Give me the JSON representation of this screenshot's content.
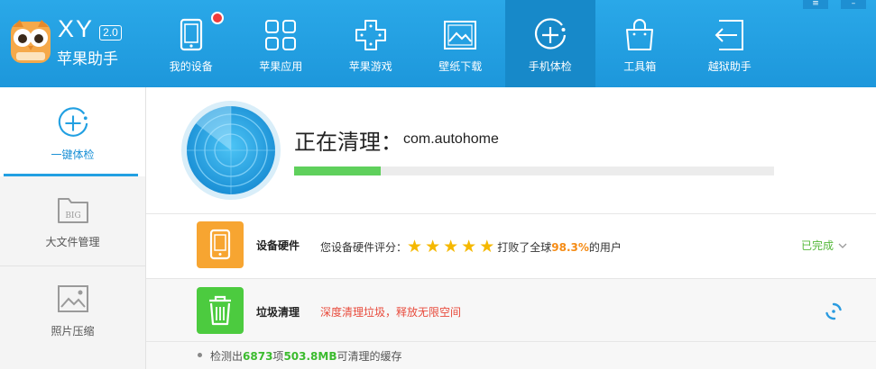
{
  "brand": {
    "name_en": "XY",
    "version": "2.0",
    "name_cn": "苹果助手"
  },
  "nav": [
    {
      "label": "我的设备",
      "icon": "tablet-icon",
      "notification": true
    },
    {
      "label": "苹果应用",
      "icon": "apps-grid-icon"
    },
    {
      "label": "苹果游戏",
      "icon": "gamepad-icon"
    },
    {
      "label": "壁纸下载",
      "icon": "image-icon"
    },
    {
      "label": "手机体检",
      "icon": "plus-circle-icon",
      "active": true
    },
    {
      "label": "工具箱",
      "icon": "toolbox-icon"
    },
    {
      "label": "越狱助手",
      "icon": "exit-icon"
    }
  ],
  "window_controls": {
    "menu": "≡",
    "minimize": "–"
  },
  "sidebar": [
    {
      "label": "一键体检",
      "icon": "plus-circle-icon",
      "active": true
    },
    {
      "label": "大文件管理",
      "icon": "big-folder-icon",
      "badge": "BIG"
    },
    {
      "label": "照片压缩",
      "icon": "photo-icon"
    }
  ],
  "scan": {
    "title": "正在清理：",
    "target": "com.autohome",
    "progress_percent": 18
  },
  "checks": {
    "hardware": {
      "title": "设备硬件",
      "prefix": "您设备硬件评分：",
      "stars": 5,
      "beat_text": "打败了全球",
      "percent": "98.3%",
      "suffix": "的用户",
      "status": "已完成"
    },
    "junk": {
      "title": "垃圾清理",
      "desc": "深度清理垃圾，释放无限空间"
    }
  },
  "detail": {
    "part1": "检测出",
    "count": "6873",
    "part2": "项",
    "size": "503.8MB",
    "part3": "可清理的缓存"
  },
  "colors": {
    "header": "#1d97db",
    "active_nav": "#1789c9",
    "progress": "#5fd05c",
    "hardware_icon": "#f7a531",
    "junk_icon": "#4ccb3f",
    "accent": "#22a0e2"
  }
}
